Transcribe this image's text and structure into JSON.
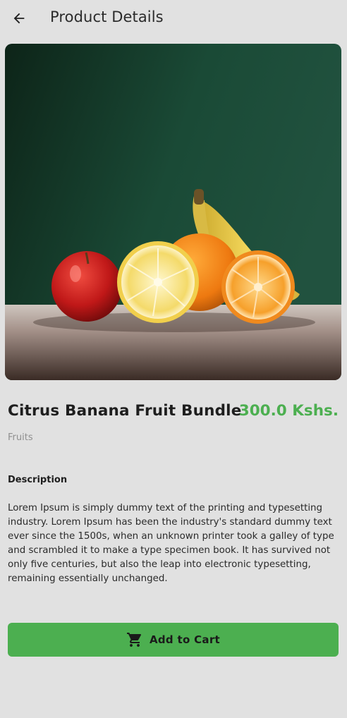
{
  "app_bar": {
    "title": "Product Details",
    "back_icon": "arrow-back-icon"
  },
  "product": {
    "name": "Citrus Banana Fruit Bundle",
    "price": "300.0 Kshs.",
    "category": "Fruits",
    "image_icon": "product-photo",
    "colors": {
      "price": "#4caf50",
      "background": "#e1e1e1"
    }
  },
  "description": {
    "heading": "Description",
    "body": "Lorem Ipsum is simply dummy text of the printing and typesetting industry. Lorem Ipsum has been the industry's standard dummy text ever since the 1500s, when an unknown printer took a galley of type and scrambled it to make a type specimen book. It has survived not only five centuries, but also the leap into electronic typesetting, remaining essentially unchanged."
  },
  "cart_button": {
    "label": "Add to Cart",
    "icon": "shopping-cart-icon",
    "color": "#4caf50"
  }
}
